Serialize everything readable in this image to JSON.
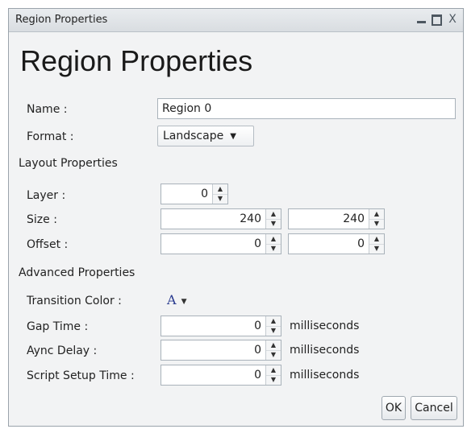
{
  "window": {
    "title": "Region Properties",
    "controls": {
      "minimize": "_",
      "maximize": "□",
      "close": "X"
    }
  },
  "heading": "Region Properties",
  "fields": {
    "name_label": "Name :",
    "name_value": "Region 0",
    "format_label": "Format :",
    "format_value": "Landscape"
  },
  "layout": {
    "section_title": "Layout Properties",
    "layer_label": "Layer :",
    "layer_value": "0",
    "size_label": "Size :",
    "size_width": "240",
    "size_height": "240",
    "offset_label": "Offset :",
    "offset_x": "0",
    "offset_y": "0"
  },
  "advanced": {
    "section_title": "Advanced Properties",
    "transition_color_label": "Transition Color :",
    "transition_color_glyph": "A",
    "gap_time_label": "Gap Time :",
    "gap_time_value": "0",
    "async_delay_label": "Aync Delay :",
    "async_delay_value": "0",
    "script_setup_label": "Script Setup Time :",
    "script_setup_value": "0",
    "units": "milliseconds"
  },
  "buttons": {
    "ok": "OK",
    "cancel": "Cancel"
  },
  "icons": {
    "spinner_up": "up-arrow-icon",
    "spinner_down": "down-arrow-icon",
    "dropdown": "caret-down-icon"
  },
  "colors": {
    "window_bg": "#f2f3f4",
    "titlebar_bg": "#dfe3e6",
    "color_glyph": "#2a3b8f"
  }
}
